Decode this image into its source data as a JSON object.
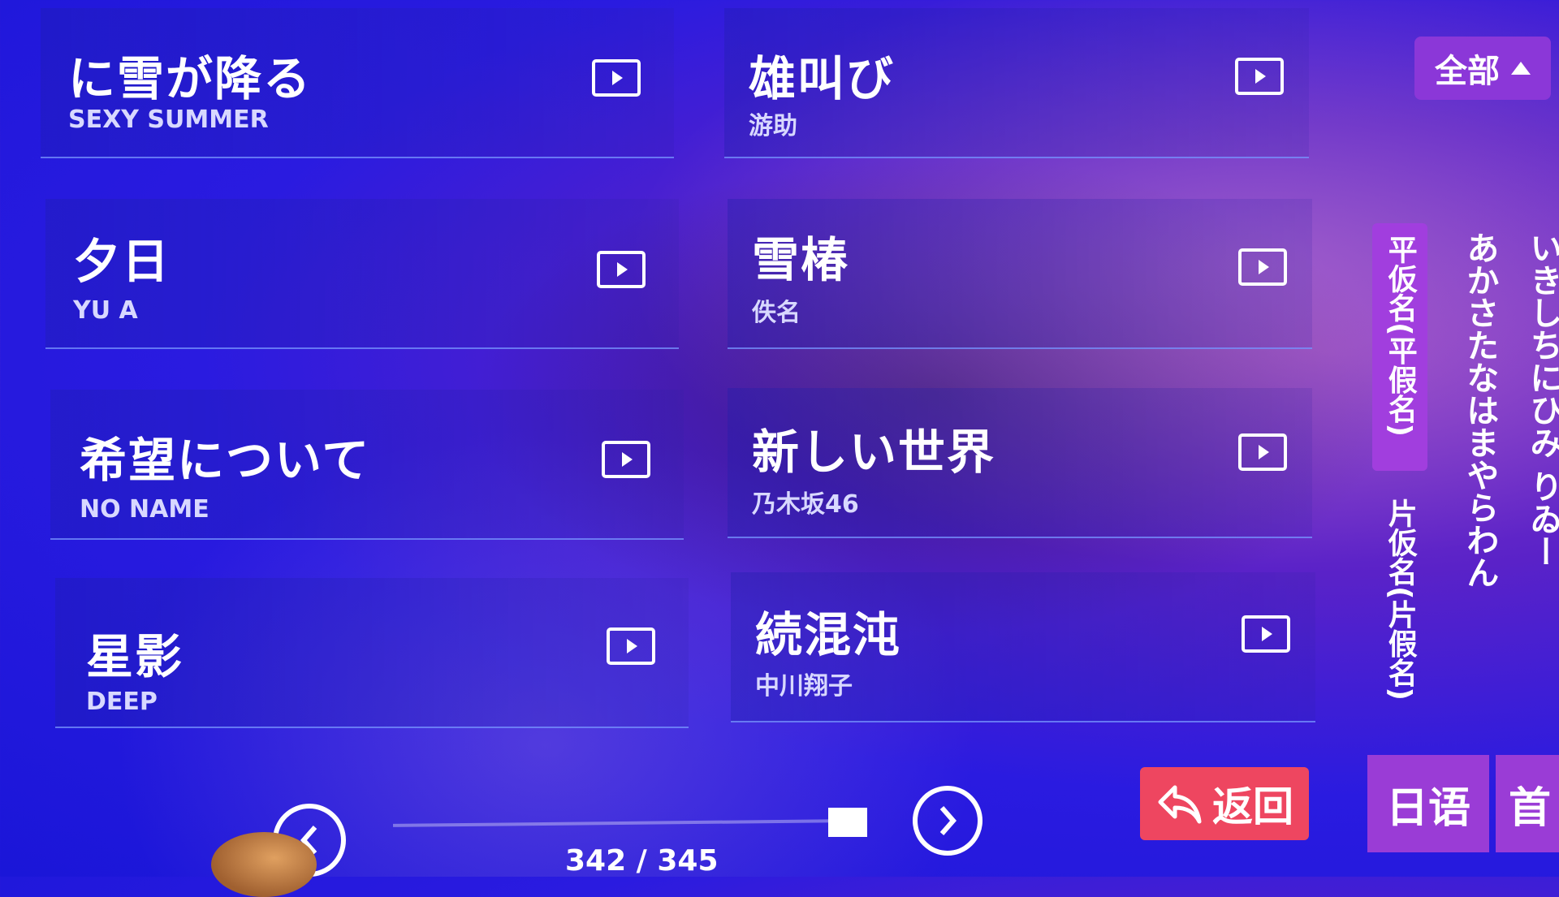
{
  "songs": [
    {
      "title": "に雪が降る",
      "artist": "SEXY SUMMER"
    },
    {
      "title": "雄叫び",
      "artist": "游助"
    },
    {
      "title": "夕日",
      "artist": "YU A"
    },
    {
      "title": "雪椿",
      "artist": "佚名"
    },
    {
      "title": "希望について",
      "artist": "NO NAME"
    },
    {
      "title": "新しい世界",
      "artist": "乃木坂46"
    },
    {
      "title": "星影",
      "artist": "DEEP"
    },
    {
      "title": "続混沌",
      "artist": "中川翔子"
    }
  ],
  "filter": {
    "all_label": "全部"
  },
  "kana_tabs": {
    "hiragana": "平仮名(平假名)",
    "katakana": "片仮名(片假名)"
  },
  "kana_columns": [
    "あかさたなはまやらわん",
    "いきしちにひみ りゐー"
  ],
  "buttons": {
    "return_label": "返回",
    "language_label": "日语",
    "home_label": "首"
  },
  "pager": {
    "current": 342,
    "total": 345,
    "text": "342 / 345"
  },
  "colors": {
    "accent_purple": "#9a3cd6",
    "return_red": "#ee4660"
  }
}
